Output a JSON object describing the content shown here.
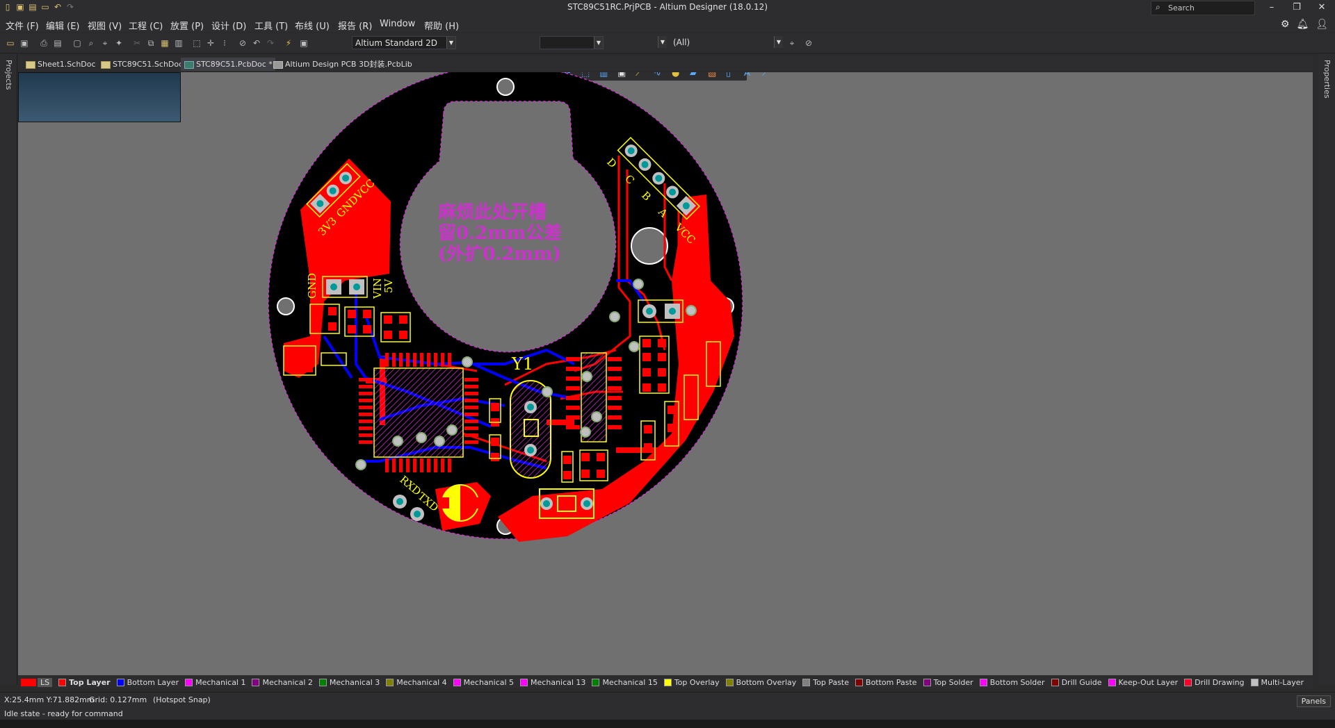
{
  "window": {
    "title": "STC89C51RC.PrjPCB - Altium Designer (18.0.12)",
    "search_placeholder": "Search"
  },
  "menu": [
    "文件 (F)",
    "编辑 (E)",
    "视图 (V)",
    "工程 (C)",
    "放置 (P)",
    "设计 (D)",
    "工具 (T)",
    "布线 (U)",
    "报告 (R)",
    "Window",
    "帮助 (H)"
  ],
  "toolbar": {
    "view_combo": "Altium Standard 2D",
    "filter_combo": "(All)"
  },
  "side_panels": {
    "left": "Projects",
    "right": "Properties"
  },
  "tabs": [
    {
      "label": "Sheet1.SchDoc",
      "active": false
    },
    {
      "label": "STC89C51.SchDoc",
      "active": false
    },
    {
      "label": "STC89C51.PcbDoc *",
      "active": true
    },
    {
      "label": "Altium Design PCB 3D封装.PcbLib",
      "active": false
    }
  ],
  "pcb": {
    "note_lines": [
      "麻烦此处开槽",
      "留0.2mm公差",
      "(外扩0.2mm)"
    ],
    "header_left_labels": [
      "3V3",
      "GND",
      "VCC"
    ],
    "header_right_labels": [
      "D",
      "C",
      "B",
      "A",
      "VCC"
    ],
    "power_labels": [
      "GND",
      "VIN",
      "5V"
    ],
    "crystal_label": "Y1",
    "serial_labels": [
      "RXD",
      "TXD"
    ]
  },
  "layers": [
    {
      "name": "LS",
      "color": "#ff0000"
    },
    {
      "name": "Top Layer",
      "color": "#ff0000"
    },
    {
      "name": "Bottom Layer",
      "color": "#0000ff"
    },
    {
      "name": "Mechanical 1",
      "color": "#ff00ff"
    },
    {
      "name": "Mechanical 2",
      "color": "#800080"
    },
    {
      "name": "Mechanical 3",
      "color": "#008000"
    },
    {
      "name": "Mechanical 4",
      "color": "#808000"
    },
    {
      "name": "Mechanical 5",
      "color": "#ff00ff"
    },
    {
      "name": "Mechanical 13",
      "color": "#ff00ff"
    },
    {
      "name": "Mechanical 15",
      "color": "#008000"
    },
    {
      "name": "Top Overlay",
      "color": "#ffff00"
    },
    {
      "name": "Bottom Overlay",
      "color": "#808000"
    },
    {
      "name": "Top Paste",
      "color": "#808080"
    },
    {
      "name": "Bottom Paste",
      "color": "#800000"
    },
    {
      "name": "Top Solder",
      "color": "#800080"
    },
    {
      "name": "Bottom Solder",
      "color": "#ff00ff"
    },
    {
      "name": "Drill Guide",
      "color": "#800000"
    },
    {
      "name": "Keep-Out Layer",
      "color": "#ff00ff"
    },
    {
      "name": "Drill Drawing",
      "color": "#ff002a"
    },
    {
      "name": "Multi-Layer",
      "color": "#c0c0c0"
    }
  ],
  "status": {
    "coords": "X:25.4mm Y:71.882mm",
    "grid": "Grid: 0.127mm",
    "snap": "(Hotspot Snap)",
    "message": "Idle state - ready for command",
    "panels_button": "Panels"
  }
}
